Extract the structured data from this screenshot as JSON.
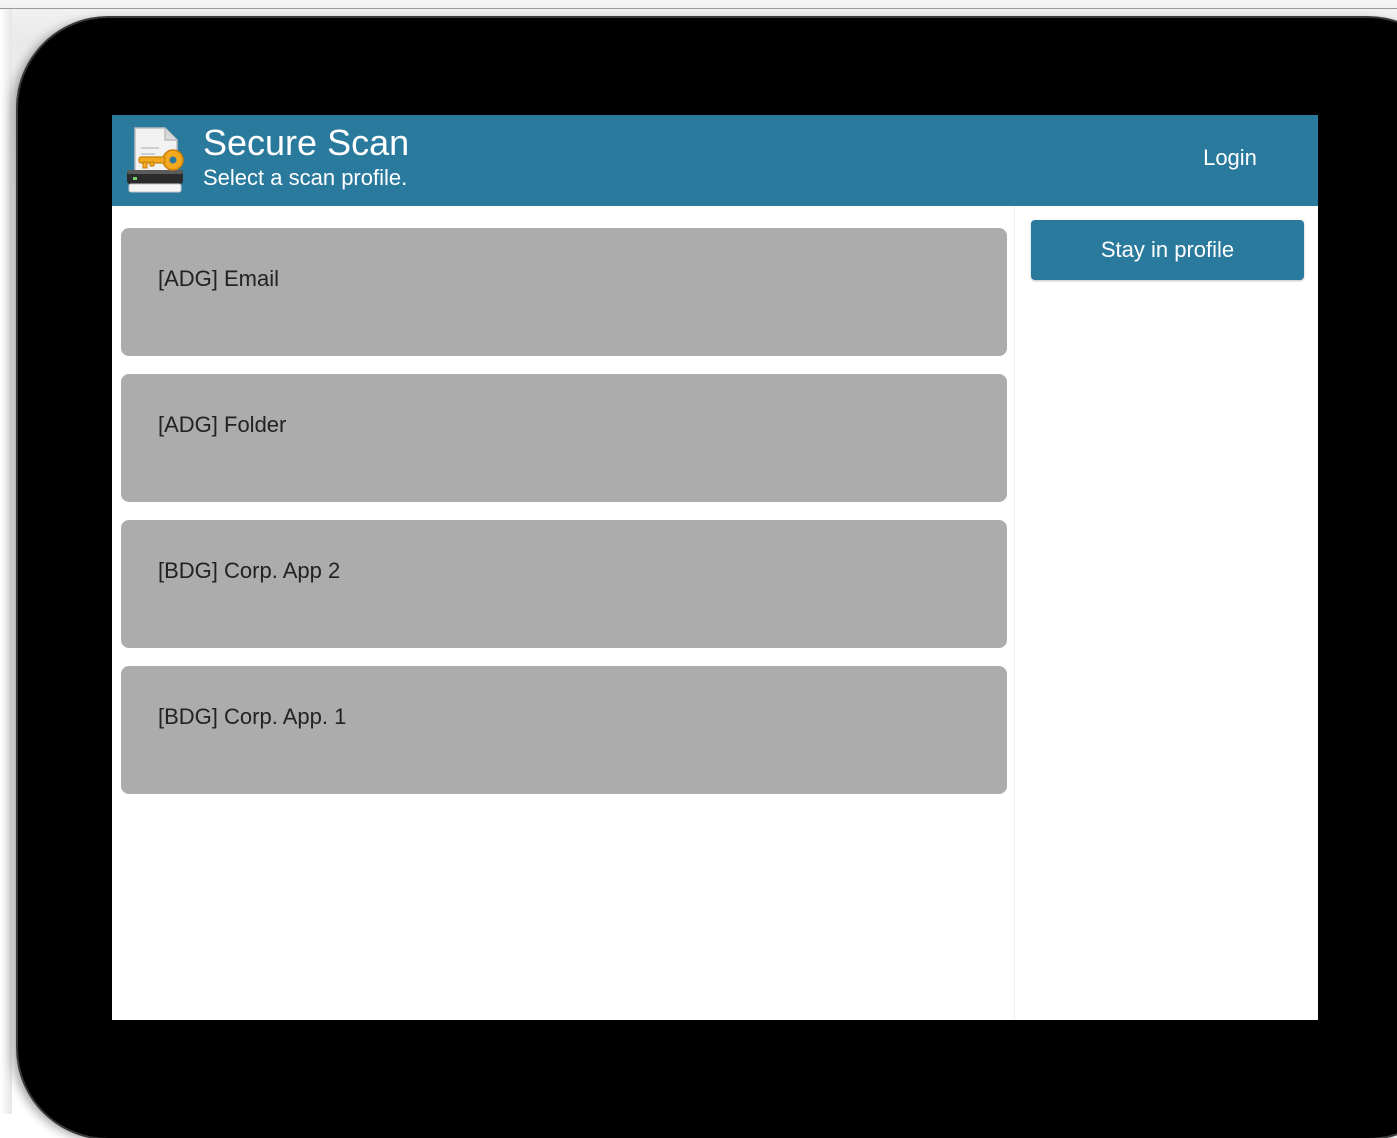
{
  "header": {
    "title": "Secure Scan",
    "subtitle": "Select a scan profile.",
    "login_label": "Login",
    "app_icon": "scanner-key-icon"
  },
  "profiles": [
    {
      "label": "[ADG] Email"
    },
    {
      "label": "[ADG] Folder"
    },
    {
      "label": "[BDG] Corp. App 2"
    },
    {
      "label": "[BDG] Corp. App. 1"
    }
  ],
  "sidebar": {
    "stay_in_profile_label": "Stay in profile"
  },
  "colors": {
    "header_bg": "#2a7a9e",
    "profile_bg": "#acacac",
    "device_bezel": "#000000"
  }
}
